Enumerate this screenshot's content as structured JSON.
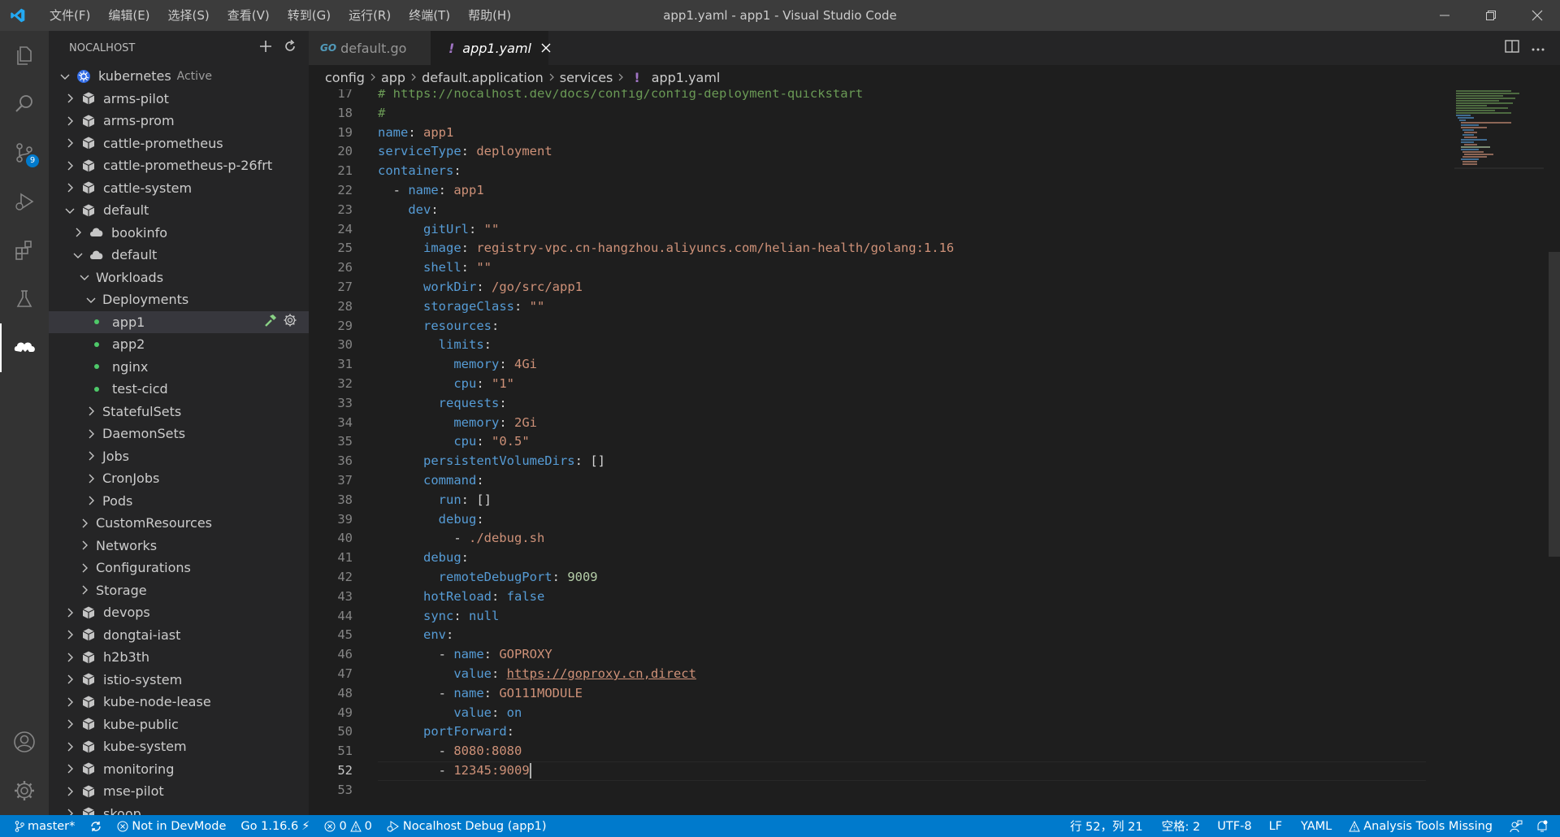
{
  "window": {
    "title": "app1.yaml - app1 - Visual Studio Code",
    "menu": [
      "文件(F)",
      "编辑(E)",
      "选择(S)",
      "查看(V)",
      "转到(G)",
      "运行(R)",
      "终端(T)",
      "帮助(H)"
    ]
  },
  "activity_bar": {
    "scm_badge": "9"
  },
  "sidebar": {
    "title": "NOCALHOST",
    "tree": [
      {
        "label": "kubernetes",
        "status": "Active",
        "indent": 0,
        "kind": "cluster",
        "expanded": true
      },
      {
        "label": "arms-pilot",
        "indent": 1,
        "kind": "namespace",
        "expanded": false
      },
      {
        "label": "arms-prom",
        "indent": 1,
        "kind": "namespace",
        "expanded": false
      },
      {
        "label": "cattle-prometheus",
        "indent": 1,
        "kind": "namespace",
        "expanded": false
      },
      {
        "label": "cattle-prometheus-p-26frt",
        "indent": 1,
        "kind": "namespace",
        "expanded": false
      },
      {
        "label": "cattle-system",
        "indent": 1,
        "kind": "namespace",
        "expanded": false
      },
      {
        "label": "default",
        "indent": 1,
        "kind": "namespace",
        "expanded": true
      },
      {
        "label": "bookinfo",
        "indent": 2,
        "kind": "app",
        "expanded": false
      },
      {
        "label": "default",
        "indent": 2,
        "kind": "app",
        "expanded": true
      },
      {
        "label": "Workloads",
        "indent": 3,
        "kind": "folder",
        "expanded": true
      },
      {
        "label": "Deployments",
        "indent": 4,
        "kind": "folder",
        "expanded": true
      },
      {
        "label": "app1",
        "indent": 5,
        "kind": "deployment",
        "selected": true
      },
      {
        "label": "app2",
        "indent": 5,
        "kind": "deployment"
      },
      {
        "label": "nginx",
        "indent": 5,
        "kind": "deployment"
      },
      {
        "label": "test-cicd",
        "indent": 5,
        "kind": "deployment"
      },
      {
        "label": "StatefulSets",
        "indent": 4,
        "kind": "folder",
        "expanded": false
      },
      {
        "label": "DaemonSets",
        "indent": 4,
        "kind": "folder",
        "expanded": false
      },
      {
        "label": "Jobs",
        "indent": 4,
        "kind": "folder",
        "expanded": false
      },
      {
        "label": "CronJobs",
        "indent": 4,
        "kind": "folder",
        "expanded": false
      },
      {
        "label": "Pods",
        "indent": 4,
        "kind": "folder",
        "expanded": false
      },
      {
        "label": "CustomResources",
        "indent": 3,
        "kind": "folder",
        "expanded": false
      },
      {
        "label": "Networks",
        "indent": 3,
        "kind": "folder",
        "expanded": false
      },
      {
        "label": "Configurations",
        "indent": 3,
        "kind": "folder",
        "expanded": false
      },
      {
        "label": "Storage",
        "indent": 3,
        "kind": "folder",
        "expanded": false
      },
      {
        "label": "devops",
        "indent": 1,
        "kind": "namespace",
        "expanded": false
      },
      {
        "label": "dongtai-iast",
        "indent": 1,
        "kind": "namespace",
        "expanded": false
      },
      {
        "label": "h2b3th",
        "indent": 1,
        "kind": "namespace",
        "expanded": false
      },
      {
        "label": "istio-system",
        "indent": 1,
        "kind": "namespace",
        "expanded": false
      },
      {
        "label": "kube-node-lease",
        "indent": 1,
        "kind": "namespace",
        "expanded": false
      },
      {
        "label": "kube-public",
        "indent": 1,
        "kind": "namespace",
        "expanded": false
      },
      {
        "label": "kube-system",
        "indent": 1,
        "kind": "namespace",
        "expanded": false
      },
      {
        "label": "monitoring",
        "indent": 1,
        "kind": "namespace",
        "expanded": false
      },
      {
        "label": "mse-pilot",
        "indent": 1,
        "kind": "namespace",
        "expanded": false
      },
      {
        "label": "skoop",
        "indent": 1,
        "kind": "namespace",
        "expanded": false
      }
    ]
  },
  "tabs": [
    {
      "label": "default.go",
      "icon": "go-icon",
      "active": false
    },
    {
      "label": "app1.yaml",
      "icon": "exclamation-icon",
      "active": true
    }
  ],
  "breadcrumb": [
    "config",
    "app",
    "default.application",
    "services",
    "app1.yaml"
  ],
  "editor": {
    "first_line_number": 17,
    "current_line": 52,
    "lines": [
      [
        [
          "# ",
          "c"
        ],
        [
          "https://nocalhost.dev/docs/config/config-deployment-quickstart",
          "c"
        ]
      ],
      [
        [
          "#",
          "c"
        ]
      ],
      [
        [
          "name",
          "k"
        ],
        [
          ": ",
          "p"
        ],
        [
          "app1",
          "s"
        ]
      ],
      [
        [
          "serviceType",
          "k"
        ],
        [
          ": ",
          "p"
        ],
        [
          "deployment",
          "s"
        ]
      ],
      [
        [
          "containers",
          "k"
        ],
        [
          ":",
          "p"
        ]
      ],
      [
        [
          "  - ",
          "p"
        ],
        [
          "name",
          "k"
        ],
        [
          ": ",
          "p"
        ],
        [
          "app1",
          "s"
        ]
      ],
      [
        [
          "    ",
          "p"
        ],
        [
          "dev",
          "k"
        ],
        [
          ":",
          "p"
        ]
      ],
      [
        [
          "      ",
          "p"
        ],
        [
          "gitUrl",
          "k"
        ],
        [
          ": ",
          "p"
        ],
        [
          "\"\"",
          "s"
        ]
      ],
      [
        [
          "      ",
          "p"
        ],
        [
          "image",
          "k"
        ],
        [
          ": ",
          "p"
        ],
        [
          "registry-vpc.cn-hangzhou.aliyuncs.com/helian-health/golang:1.16",
          "s"
        ]
      ],
      [
        [
          "      ",
          "p"
        ],
        [
          "shell",
          "k"
        ],
        [
          ": ",
          "p"
        ],
        [
          "\"\"",
          "s"
        ]
      ],
      [
        [
          "      ",
          "p"
        ],
        [
          "workDir",
          "k"
        ],
        [
          ": ",
          "p"
        ],
        [
          "/go/src/app1",
          "s"
        ]
      ],
      [
        [
          "      ",
          "p"
        ],
        [
          "storageClass",
          "k"
        ],
        [
          ": ",
          "p"
        ],
        [
          "\"\"",
          "s"
        ]
      ],
      [
        [
          "      ",
          "p"
        ],
        [
          "resources",
          "k"
        ],
        [
          ":",
          "p"
        ]
      ],
      [
        [
          "        ",
          "p"
        ],
        [
          "limits",
          "k"
        ],
        [
          ":",
          "p"
        ]
      ],
      [
        [
          "          ",
          "p"
        ],
        [
          "memory",
          "k"
        ],
        [
          ": ",
          "p"
        ],
        [
          "4Gi",
          "s"
        ]
      ],
      [
        [
          "          ",
          "p"
        ],
        [
          "cpu",
          "k"
        ],
        [
          ": ",
          "p"
        ],
        [
          "\"1\"",
          "s"
        ]
      ],
      [
        [
          "        ",
          "p"
        ],
        [
          "requests",
          "k"
        ],
        [
          ":",
          "p"
        ]
      ],
      [
        [
          "          ",
          "p"
        ],
        [
          "memory",
          "k"
        ],
        [
          ": ",
          "p"
        ],
        [
          "2Gi",
          "s"
        ]
      ],
      [
        [
          "          ",
          "p"
        ],
        [
          "cpu",
          "k"
        ],
        [
          ": ",
          "p"
        ],
        [
          "\"0.5\"",
          "s"
        ]
      ],
      [
        [
          "      ",
          "p"
        ],
        [
          "persistentVolumeDirs",
          "k"
        ],
        [
          ": ",
          "p"
        ],
        [
          "[]",
          "p"
        ]
      ],
      [
        [
          "      ",
          "p"
        ],
        [
          "command",
          "k"
        ],
        [
          ":",
          "p"
        ]
      ],
      [
        [
          "        ",
          "p"
        ],
        [
          "run",
          "k"
        ],
        [
          ": ",
          "p"
        ],
        [
          "[]",
          "p"
        ]
      ],
      [
        [
          "        ",
          "p"
        ],
        [
          "debug",
          "k"
        ],
        [
          ":",
          "p"
        ]
      ],
      [
        [
          "          - ",
          "p"
        ],
        [
          "./debug.sh",
          "s"
        ]
      ],
      [
        [
          "      ",
          "p"
        ],
        [
          "debug",
          "k"
        ],
        [
          ":",
          "p"
        ]
      ],
      [
        [
          "        ",
          "p"
        ],
        [
          "remoteDebugPort",
          "k"
        ],
        [
          ": ",
          "p"
        ],
        [
          "9009",
          "n"
        ]
      ],
      [
        [
          "      ",
          "p"
        ],
        [
          "hotReload",
          "k"
        ],
        [
          ": ",
          "p"
        ],
        [
          "false",
          "k"
        ]
      ],
      [
        [
          "      ",
          "p"
        ],
        [
          "sync",
          "k"
        ],
        [
          ": ",
          "p"
        ],
        [
          "null",
          "k"
        ]
      ],
      [
        [
          "      ",
          "p"
        ],
        [
          "env",
          "k"
        ],
        [
          ":",
          "p"
        ]
      ],
      [
        [
          "        - ",
          "p"
        ],
        [
          "name",
          "k"
        ],
        [
          ": ",
          "p"
        ],
        [
          "GOPROXY",
          "s"
        ]
      ],
      [
        [
          "          ",
          "p"
        ],
        [
          "value",
          "k"
        ],
        [
          ": ",
          "p"
        ],
        [
          "https://goproxy.cn,direct",
          "lnk"
        ]
      ],
      [
        [
          "        - ",
          "p"
        ],
        [
          "name",
          "k"
        ],
        [
          ": ",
          "p"
        ],
        [
          "GO111MODULE",
          "s"
        ]
      ],
      [
        [
          "          ",
          "p"
        ],
        [
          "value",
          "k"
        ],
        [
          ": ",
          "p"
        ],
        [
          "on",
          "k"
        ]
      ],
      [
        [
          "      ",
          "p"
        ],
        [
          "portForward",
          "k"
        ],
        [
          ":",
          "p"
        ]
      ],
      [
        [
          "        - ",
          "p"
        ],
        [
          "8080:8080",
          "s"
        ]
      ],
      [
        [
          "        - ",
          "p"
        ],
        [
          "12345:9009",
          "s"
        ]
      ],
      []
    ]
  },
  "statusbar": {
    "branch": "master*",
    "devmode": "Not in DevMode",
    "go_version": "Go 1.16.6",
    "errors": "0",
    "warnings": "0",
    "debug": "Nocalhost Debug (app1)",
    "cursor_pos": "行 52，列 21",
    "spaces": "空格: 2",
    "encoding": "UTF-8",
    "eol": "LF",
    "language": "YAML",
    "analysis": "Analysis Tools Missing"
  },
  "colors": {
    "accent": "#007acc",
    "keyword": "#569cd6",
    "string": "#ce9178",
    "number": "#b5cea8",
    "comment": "#6a9955",
    "running_dot": "#4ec969"
  }
}
